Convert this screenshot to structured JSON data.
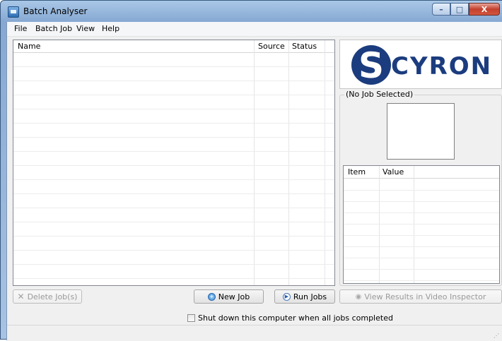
{
  "window": {
    "title": "Batch Analyser",
    "minimize_glyph": "–",
    "maximize_glyph": "□",
    "close_glyph": "X"
  },
  "menu": {
    "items": [
      {
        "label": "File"
      },
      {
        "label": "Batch Job"
      },
      {
        "label": "View"
      },
      {
        "label": "Help"
      }
    ]
  },
  "job_list": {
    "columns": [
      "Name",
      "Source",
      "Status"
    ],
    "rows": []
  },
  "logo": {
    "letter": "S",
    "word": "CYRON",
    "color": "#1b3c7e"
  },
  "details": {
    "group_title": "(No Job Selected)",
    "properties": {
      "columns": [
        "Item",
        "Value"
      ],
      "rows": []
    }
  },
  "buttons": {
    "delete": {
      "label": "Delete Job(s)",
      "icon": "delete-icon",
      "enabled": false
    },
    "new_job": {
      "label": "New Job",
      "icon": "new-job-icon",
      "enabled": true
    },
    "run_jobs": {
      "label": "Run Jobs",
      "icon": "play-icon",
      "enabled": true
    },
    "view_results": {
      "label": "View Results in Video Inspector",
      "icon": "eye-icon",
      "enabled": false
    }
  },
  "shutdown_option": {
    "label": "Shut down this computer when all jobs completed",
    "checked": false
  }
}
